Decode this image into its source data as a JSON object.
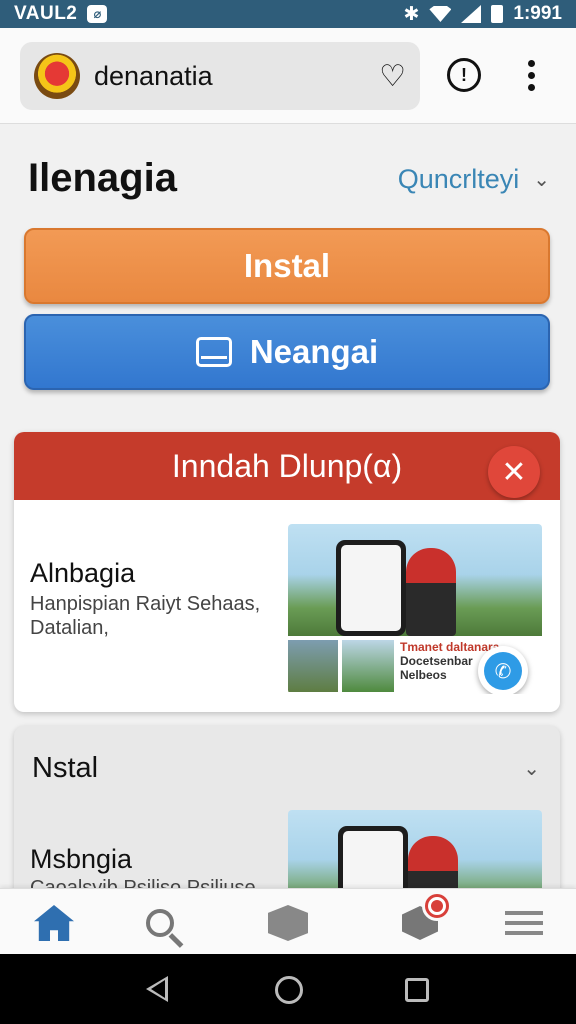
{
  "status_bar": {
    "carrier": "VAUL2",
    "sim_icon_glyph": "⌀",
    "time": "1:991",
    "icons": [
      "bluetooth-icon",
      "wifi-icon",
      "signal-icon",
      "battery-icon"
    ]
  },
  "app_bar": {
    "title": "denanatia",
    "logo": "emblem-logo",
    "heart_glyph": "♡",
    "info_glyph": "!",
    "icons": [
      "heart-icon",
      "info-icon",
      "more-vert-icon"
    ]
  },
  "main": {
    "heading": "Ilenagia",
    "dropdown": {
      "label": "Quncrlteyi",
      "chevron": "⌄"
    },
    "install_button": "Instal",
    "neangai_button": "Neangai"
  },
  "card1": {
    "banner_title": "Inndah Dlunp(α)",
    "close_glyph": "✕",
    "item_title": "Alnbagia",
    "item_desc": "Hanpispian Raiyt Sehaas, Datalian,",
    "media_text_line1": "Tmanet daltanara",
    "media_text_line2": "Docetsenbar",
    "media_text_line3": "Nelbeos",
    "call_glyph": "✆"
  },
  "card2": {
    "section_title": "Nstal",
    "chevron": "⌄",
    "item_title": "Msbngia",
    "item_desc": "Caoalsyib Psiliso Psiliuse"
  },
  "bottom_nav": {
    "items": [
      "home-icon",
      "search-icon",
      "box-icon",
      "notification-icon",
      "menu-icon"
    ],
    "active": "home-icon"
  },
  "colors": {
    "status_bar": "#2f5d7a",
    "install": "#ec8d45",
    "neangai": "#3a80d4",
    "banner": "#c53b2b",
    "close": "#e0473a",
    "dropdown_text": "#3a86b5",
    "home_active": "#2f6fb0"
  }
}
